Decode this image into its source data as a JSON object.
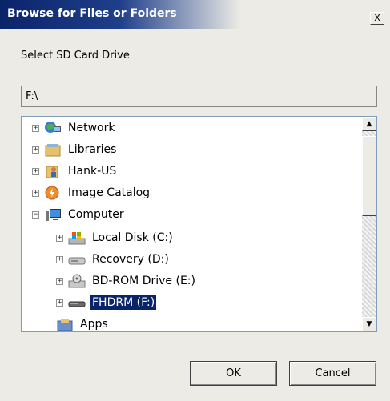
{
  "window": {
    "title": "Browse for Files or Folders",
    "close_label": "X"
  },
  "prompt": "Select SD Card Drive",
  "path_value": "F:\\",
  "tree": {
    "items": [
      {
        "label": "Network",
        "icon": "network-icon",
        "expander": "+"
      },
      {
        "label": "Libraries",
        "icon": "libraries-icon",
        "expander": "+"
      },
      {
        "label": "Hank-US",
        "icon": "user-folder-icon",
        "expander": "+"
      },
      {
        "label": "Image Catalog",
        "icon": "image-catalog-icon",
        "expander": "+"
      },
      {
        "label": "Computer",
        "icon": "computer-icon",
        "expander": "−"
      },
      {
        "label": "Local Disk (C:)",
        "icon": "local-disk-icon",
        "expander": "+"
      },
      {
        "label": "Recovery (D:)",
        "icon": "drive-icon",
        "expander": "+"
      },
      {
        "label": "BD-ROM Drive (E:)",
        "icon": "bd-rom-icon",
        "expander": "+"
      },
      {
        "label": "FHDRM (F:)",
        "icon": "removable-drive-icon",
        "expander": "+",
        "selected": true
      },
      {
        "label": "Apps",
        "icon": "apps-icon",
        "expander": ""
      }
    ]
  },
  "scroll": {
    "up": "▲",
    "down": "▼"
  },
  "buttons": {
    "ok": "OK",
    "cancel": "Cancel"
  },
  "colors": {
    "title_bar": "#0a246a",
    "selection": "#0a246a",
    "window_bg": "#ecebe6"
  }
}
